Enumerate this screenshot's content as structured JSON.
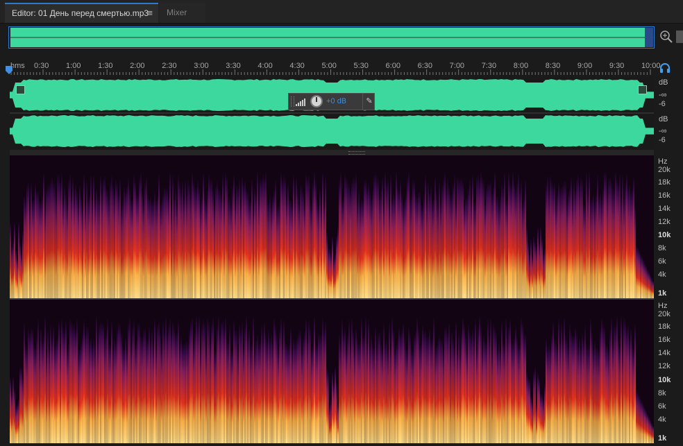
{
  "tabs": {
    "editor_label": "Editor: 01 День перед смертью.mp3",
    "menu_icon": "≡",
    "mixer_label": "Mixer"
  },
  "ruler": {
    "unit": "hms",
    "marks": [
      "0:30",
      "1:00",
      "1:30",
      "2:00",
      "2:30",
      "3:00",
      "3:30",
      "4:00",
      "4:30",
      "5:00",
      "5:30",
      "6:00",
      "6:30",
      "7:00",
      "7:30",
      "8:00",
      "8:30",
      "9:00",
      "9:30",
      "10:00"
    ]
  },
  "hud": {
    "volume_value": "+0 dB"
  },
  "db_scale": {
    "ch1": [
      "dB",
      "-∞",
      "-6"
    ],
    "ch2": [
      "dB",
      "-∞",
      "-6"
    ]
  },
  "hz_scale": [
    "Hz",
    "20k",
    "18k",
    "16k",
    "14k",
    "12k",
    "10k",
    "8k",
    "6k",
    "4k",
    "1k"
  ],
  "colors": {
    "waveform": "#3dd89e",
    "accent": "#2d7ad3",
    "spec_low": "#ffe08a",
    "spec_mid": "#e8321c",
    "spec_high": "#3b0b4e"
  },
  "icons": {
    "zoom": "zoom-icon",
    "headphones": "headphones-icon",
    "pin": "pin-icon"
  }
}
